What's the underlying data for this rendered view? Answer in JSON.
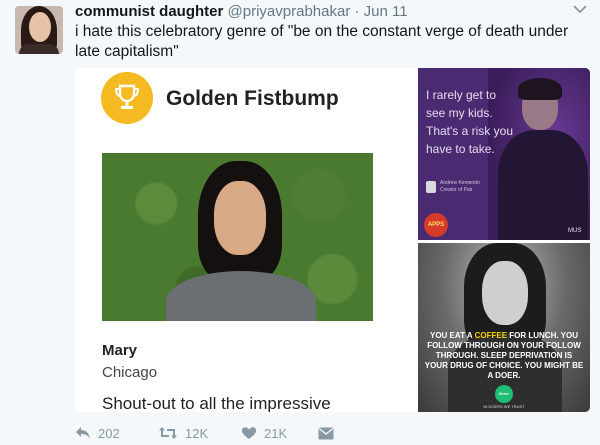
{
  "tweet": {
    "display_name": "communist daughter",
    "handle": "@priyavprabhakar",
    "dot": "·",
    "time": "Jun 11",
    "text": "i hate this celebratory genre of \"be on the constant verge of death under late capitalism\""
  },
  "media": {
    "left_card": {
      "title": "Golden Fistbump",
      "person_name": "Mary",
      "person_city": "Chicago",
      "shoutout": "Shout-out to all the impressive"
    },
    "right_top": {
      "quote": "I rarely get to see my kids. That's a risk you have to take.",
      "author": "Andrew Kemendo",
      "author_title": "Creator of Pair",
      "apps_logo": "APPS",
      "music_mark": "MUS"
    },
    "right_bottom": {
      "ad_text_1": "YOU EAT A ",
      "ad_highlight": "COFFEE",
      "ad_text_2": " FOR LUNCH. YOU FOLLOW THROUGH ON YOUR FOLLOW THROUGH. SLEEP DEPRIVATION IS YOUR DRUG OF CHOICE. YOU MIGHT BE A DOER.",
      "brand": "fiverr",
      "tagline": "IN DOERS WE TRUST"
    }
  },
  "actions": {
    "reply_count": "202",
    "retweet_count": "12K",
    "like_count": "21K"
  },
  "colors": {
    "accent": "#1da1f2",
    "muted": "#8899a6",
    "trophy": "#f5b921"
  }
}
